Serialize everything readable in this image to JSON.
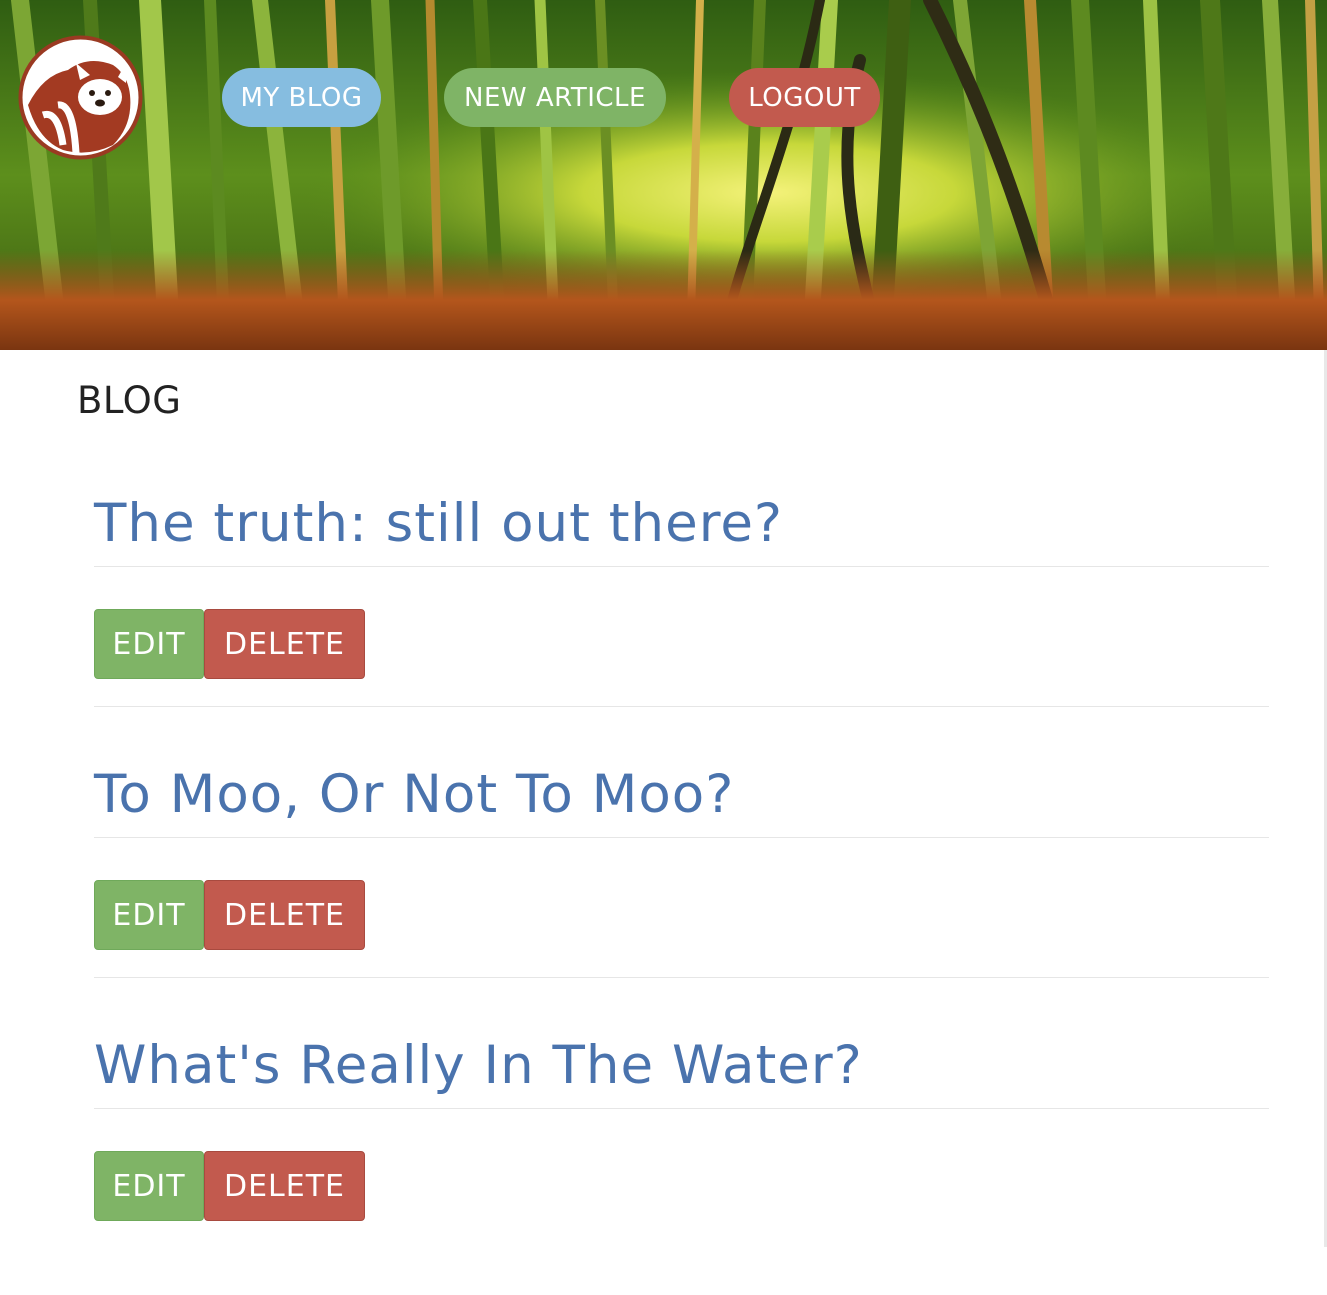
{
  "colors": {
    "my_blog": "#86bde0",
    "new_article": "#7fb466",
    "logout": "#c25a4e",
    "edit": "#7fb466",
    "delete": "#c25a4e",
    "title": "#4a73ad"
  },
  "header": {
    "logo_icon": "red-panda-logo-icon",
    "nav": {
      "my_blog": "MY BLOG",
      "new_article": "NEW ARTICLE",
      "logout": "LOGOUT"
    }
  },
  "main": {
    "heading": "BLOG",
    "articles": [
      {
        "title": "The truth: still out there?",
        "edit_label": "EDIT",
        "delete_label": "DELETE"
      },
      {
        "title": "To Moo, Or Not To Moo?",
        "edit_label": "EDIT",
        "delete_label": "DELETE"
      },
      {
        "title": "What's Really In The Water?",
        "edit_label": "EDIT",
        "delete_label": "DELETE"
      }
    ]
  }
}
